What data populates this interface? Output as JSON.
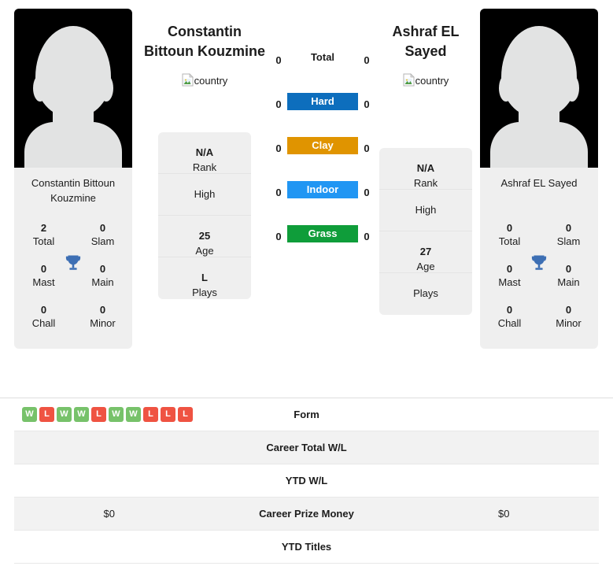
{
  "players": {
    "left": {
      "display_name_line1": "Constantin",
      "display_name_line2": "Bittoun Kouzmine",
      "card_name": "Constantin Bittoun Kouzmine",
      "country_alt": "country",
      "avatar_alt": "player photo",
      "titles": [
        {
          "num": "2",
          "label": "Total"
        },
        {
          "num": "0",
          "label": "Slam"
        },
        {
          "num": "0",
          "label": "Mast"
        },
        {
          "num": "0",
          "label": "Main"
        },
        {
          "num": "0",
          "label": "Chall"
        },
        {
          "num": "0",
          "label": "Minor"
        }
      ],
      "info": [
        {
          "value": "N/A",
          "label": "Rank"
        },
        {
          "value": "",
          "label": "High"
        },
        {
          "value": "25",
          "label": "Age"
        },
        {
          "value": "L",
          "label": "Plays"
        }
      ]
    },
    "right": {
      "display_name_line1": "Ashraf EL",
      "display_name_line2": "Sayed",
      "card_name": "Ashraf EL Sayed",
      "country_alt": "country",
      "avatar_alt": "player photo",
      "titles": [
        {
          "num": "0",
          "label": "Total"
        },
        {
          "num": "0",
          "label": "Slam"
        },
        {
          "num": "0",
          "label": "Mast"
        },
        {
          "num": "0",
          "label": "Main"
        },
        {
          "num": "0",
          "label": "Chall"
        },
        {
          "num": "0",
          "label": "Minor"
        }
      ],
      "info": [
        {
          "value": "N/A",
          "label": "Rank"
        },
        {
          "value": "",
          "label": "High"
        },
        {
          "value": "27",
          "label": "Age"
        },
        {
          "value": "",
          "label": "Plays"
        }
      ]
    }
  },
  "surfaces": [
    {
      "label": "Total",
      "left": "0",
      "right": "0",
      "color": "none",
      "text_color": "#1c1c1c"
    },
    {
      "label": "Hard",
      "left": "0",
      "right": "0",
      "color": "#0d6ebd",
      "text_color": "#ffffff"
    },
    {
      "label": "Clay",
      "left": "0",
      "right": "0",
      "color": "#e09400",
      "text_color": "#ffffff"
    },
    {
      "label": "Indoor",
      "left": "0",
      "right": "0",
      "color": "#2196f3",
      "text_color": "#ffffff"
    },
    {
      "label": "Grass",
      "left": "0",
      "right": "0",
      "color": "#0f9d3a",
      "text_color": "#ffffff"
    }
  ],
  "compare_rows": [
    {
      "label": "Form",
      "type": "form",
      "left_form": [
        "W",
        "L",
        "W",
        "W",
        "L",
        "W",
        "W",
        "L",
        "L",
        "L"
      ],
      "right_form": [],
      "left_value": "",
      "right_value": "",
      "shaded": false
    },
    {
      "label": "Career Total W/L",
      "type": "text",
      "left_value": "",
      "right_value": "",
      "shaded": true
    },
    {
      "label": "YTD W/L",
      "type": "text",
      "left_value": "",
      "right_value": "",
      "shaded": false
    },
    {
      "label": "Career Prize Money",
      "type": "text",
      "left_value": "$0",
      "right_value": "$0",
      "shaded": true
    },
    {
      "label": "YTD Titles",
      "type": "text",
      "left_value": "",
      "right_value": "",
      "shaded": false
    }
  ],
  "colors": {
    "win_badge": "#77c26a",
    "loss_badge": "#ef5342",
    "trophy": "#3d6fb4",
    "card_bg": "#efefef",
    "row_shade": "#f2f2f2"
  },
  "icons": {
    "trophy": "trophy-icon",
    "broken_image": "broken-image-icon"
  }
}
